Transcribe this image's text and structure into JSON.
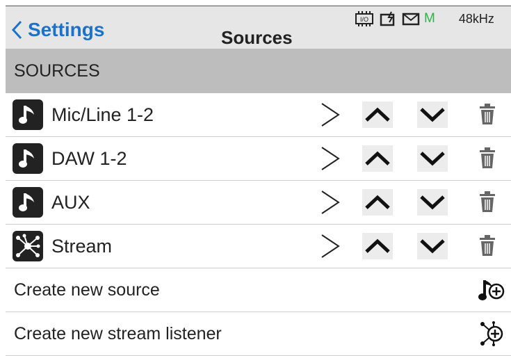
{
  "header": {
    "back_label": "Settings",
    "title": "Sources",
    "status": {
      "io_label": "I/O",
      "m_label": "M",
      "sample_rate": "48kHz"
    }
  },
  "section": {
    "title": "SOURCES"
  },
  "sources": [
    {
      "name": "Mic/Line 1-2",
      "icon": "music-note-icon"
    },
    {
      "name": "DAW 1-2",
      "icon": "music-note-icon"
    },
    {
      "name": "AUX",
      "icon": "music-note-icon"
    },
    {
      "name": "Stream",
      "icon": "network-icon"
    }
  ],
  "actions": {
    "create_source": "Create new source",
    "create_stream_listener": "Create new stream listener"
  },
  "colors": {
    "accent": "#1a73c8",
    "status_green": "#2db34a",
    "section_bg": "#bdbdbd",
    "header_bg": "#e6e6e6"
  }
}
